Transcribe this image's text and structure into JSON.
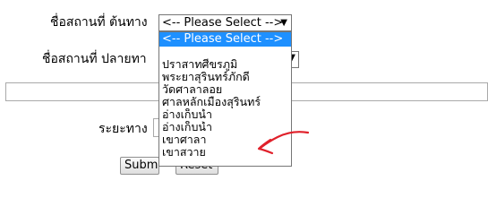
{
  "form": {
    "origin_label": "ชื่อสถานที่ ต้นทาง",
    "destination_label": "ชื่อสถานที่ ปลายทา",
    "distance_label": "ระยะทาง",
    "origin_select": {
      "selected": "<-- Please Select -->"
    },
    "submit_label": "Submit",
    "reset_label": "Reset"
  },
  "dropdown": {
    "options": [
      "<-- Please Select -->",
      "",
      "ปราสาทศีขรภูมิ",
      "พระยาสุรินทร์ภักดี",
      "วัดศาลาลอย",
      "ศาลหลักเมืองสุรินทร์",
      "อ่างเก็บน้ำ",
      "อ่างเก็บน้ำ",
      "เขาศาลา",
      "เขาสวาย"
    ],
    "highlighted_index": 0
  },
  "colors": {
    "highlight": "#1e90ff",
    "annotation": "#e0202a"
  },
  "icons": {
    "select_arrow": "chevron-down-icon",
    "annotation": "red-arrow-annotation"
  }
}
